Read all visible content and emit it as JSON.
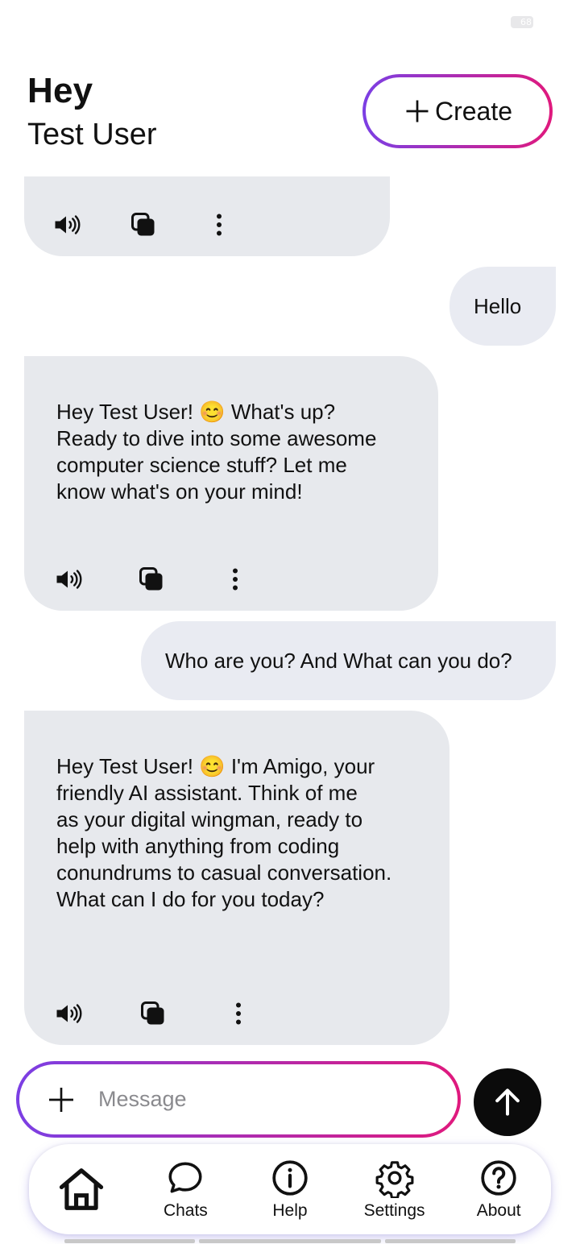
{
  "status_bar": {
    "battery": "68"
  },
  "header": {
    "greeting": "Hey",
    "user_name": "Test User",
    "create_label": "Create"
  },
  "messages": [
    {
      "role": "assistant",
      "text": ""
    },
    {
      "role": "user",
      "text": "Hello"
    },
    {
      "role": "assistant",
      "lines": [
        "Hey Test User! 😊  What's up?",
        "Ready to dive into some awesome",
        "computer science stuff?  Let me",
        "know what's on your mind!"
      ]
    },
    {
      "role": "user",
      "text": "Who are you? And What can you do?"
    },
    {
      "role": "assistant",
      "lines": [
        "Hey Test User! 😊 I'm Amigo, your",
        "friendly AI assistant.  Think of me",
        "as your digital wingman, ready to",
        "help with anything from coding",
        "conundrums to casual conversation.",
        "What can I do for you today?"
      ]
    }
  ],
  "message_actions": {
    "icons": [
      "volume-icon",
      "copy-icon",
      "more-vertical-icon"
    ]
  },
  "composer": {
    "placeholder": "Message",
    "value": ""
  },
  "nav": {
    "items": [
      {
        "label": "",
        "icon": "home-icon"
      },
      {
        "label": "Chats",
        "icon": "chat-bubble-icon"
      },
      {
        "label": "Help",
        "icon": "info-icon"
      },
      {
        "label": "Settings",
        "icon": "gear-icon"
      },
      {
        "label": "About",
        "icon": "question-icon"
      }
    ]
  },
  "colors": {
    "gradient_start": "#7b3fe4",
    "gradient_end": "#e0197d",
    "bubble": "#e7e9ed",
    "send_button": "#0b0b0b"
  }
}
